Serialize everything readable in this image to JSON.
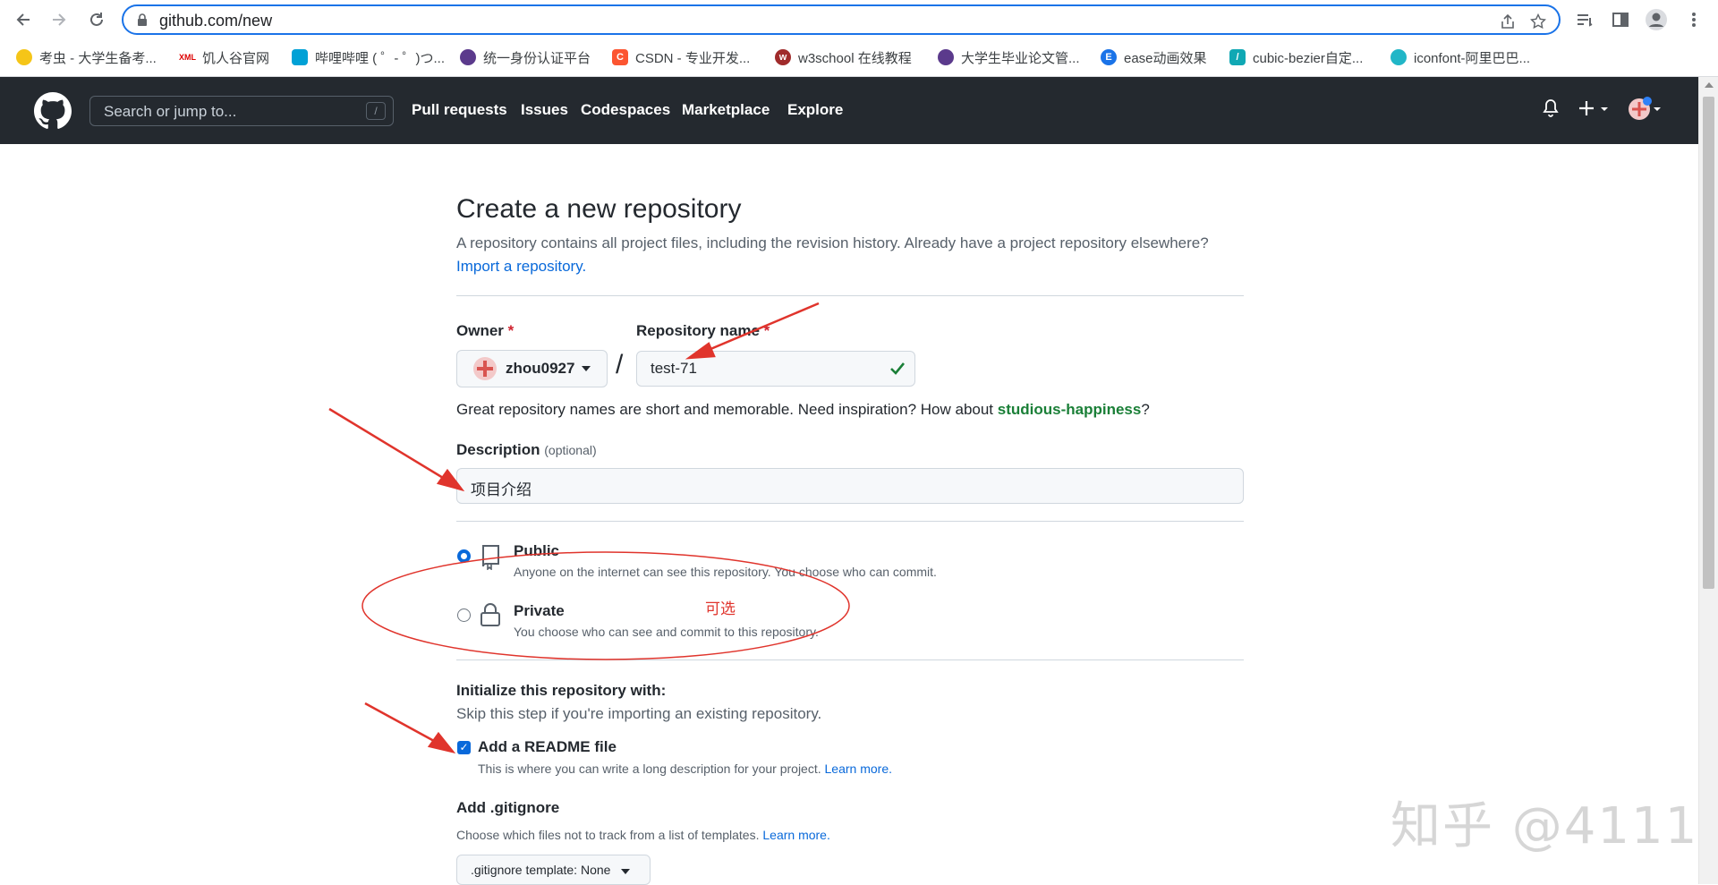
{
  "browser": {
    "url": "github.com/new",
    "bookmarks": [
      {
        "label": "考虫 - 大学生备考...",
        "color": "#f5c518",
        "glyph": "●"
      },
      {
        "label": "饥人谷官网",
        "color": "#ffffff",
        "glyph": "X"
      },
      {
        "label": "哔哩哔哩 ( ゜- ゜)つ...",
        "color": "#00a1d6",
        "glyph": "B"
      },
      {
        "label": "统一身份认证平台",
        "color": "#5b3a8c",
        "glyph": "◆"
      },
      {
        "label": "CSDN - 专业开发...",
        "color": "#fc5531",
        "glyph": "C"
      },
      {
        "label": "w3school 在线教程",
        "color": "#a02b2b",
        "glyph": "w"
      },
      {
        "label": "大学生毕业论文管...",
        "color": "#5b3a8c",
        "glyph": "◆"
      },
      {
        "label": "ease动画效果",
        "color": "#1a73e8",
        "glyph": "E"
      },
      {
        "label": "cubic-bezier自定...",
        "color": "#10a8b4",
        "glyph": "/"
      },
      {
        "label": "iconfont-阿里巴巴...",
        "color": "#21b6c7",
        "glyph": "◉"
      }
    ]
  },
  "header": {
    "search_placeholder": "Search or jump to...",
    "search_shortcut": "/",
    "nav": [
      "Pull requests",
      "Issues",
      "Codespaces",
      "Marketplace",
      "Explore"
    ]
  },
  "page": {
    "title": "Create a new repository",
    "subtitle": "A repository contains all project files, including the revision history. Already have a project repository elsewhere?",
    "import_link": "Import a repository.",
    "owner_label": "Owner",
    "required_mark": "*",
    "owner_value": "zhou0927",
    "repo_label": "Repository name",
    "repo_value": "test-71",
    "help_prefix": "Great repository names are short and memorable. Need inspiration? How about ",
    "help_suggestion": "studious-happiness",
    "help_suffix": "?",
    "desc_label": "Description",
    "desc_optional": "(optional)",
    "desc_value": "项目介绍",
    "public_title": "Public",
    "public_desc": "Anyone on the internet can see this repository. You choose who can commit.",
    "private_title": "Private",
    "private_desc": "You choose who can see and commit to this repository.",
    "init_title": "Initialize this repository with:",
    "init_sub": "Skip this step if you're importing an existing repository.",
    "readme_label": "Add a README file",
    "readme_desc": "This is where you can write a long description for your project.",
    "learn_more": "Learn more.",
    "gitignore_label": "Add .gitignore",
    "gitignore_desc": "Choose which files not to track from a list of templates.",
    "gitignore_btn": ".gitignore template: None"
  },
  "annotation": {
    "optional_note": "可选",
    "color": "#e0342c"
  },
  "watermark": "知乎 @4111"
}
